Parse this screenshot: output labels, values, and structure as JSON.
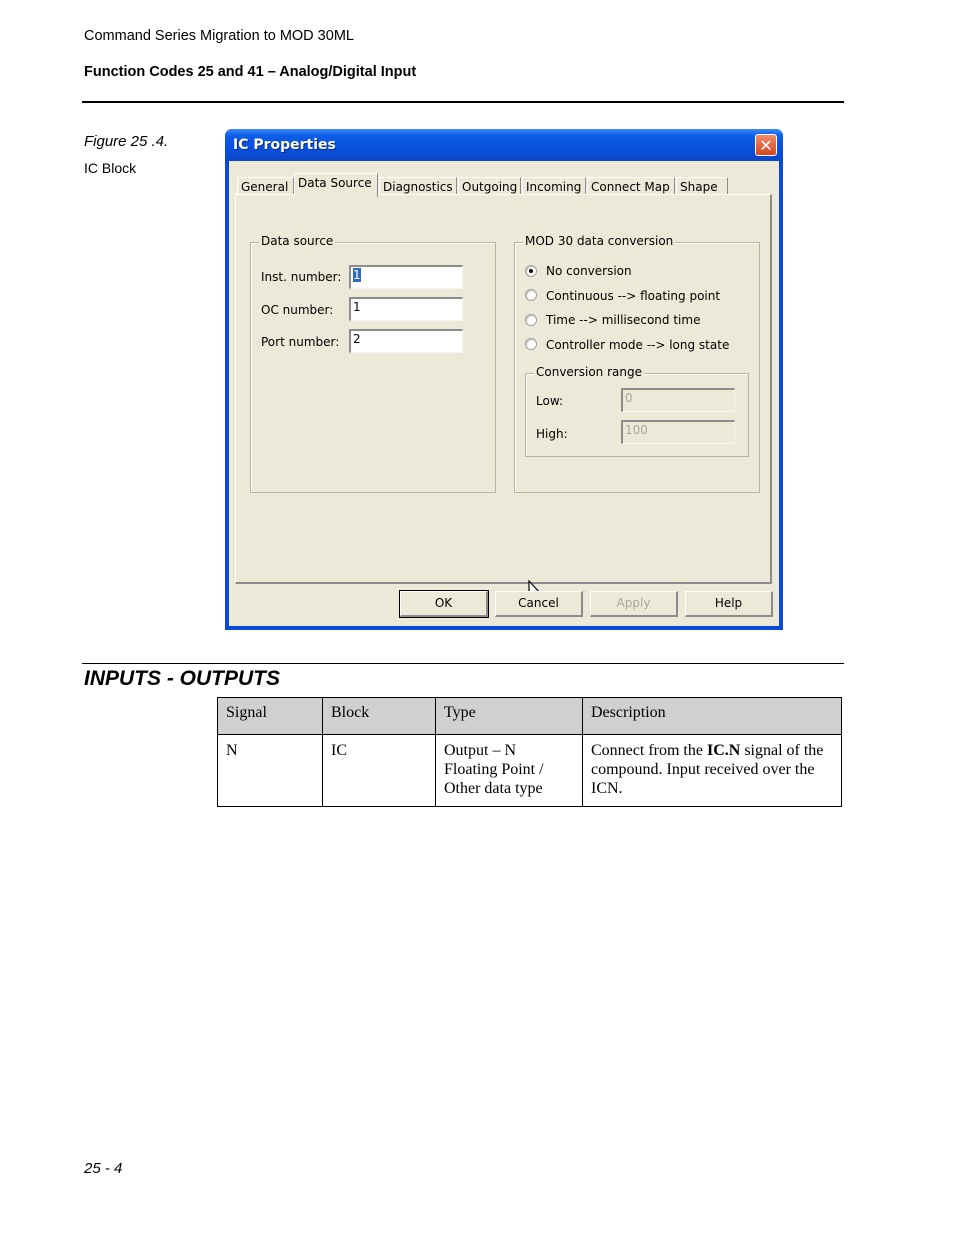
{
  "header": {
    "doc_title": "Command Series Migration to MOD 30ML",
    "section_title": "Function Codes 25 and 41 – Analog/Digital Input"
  },
  "figure": {
    "label": "Figure 25 .4.",
    "caption": "IC Block"
  },
  "dialog": {
    "title": "IC Properties",
    "close_icon": "close-icon",
    "tabs": [
      {
        "label": "General",
        "active": false
      },
      {
        "label": "Data Source",
        "active": true
      },
      {
        "label": "Diagnostics",
        "active": false
      },
      {
        "label": "Outgoing",
        "active": false
      },
      {
        "label": "Incoming",
        "active": false
      },
      {
        "label": "Connect Map",
        "active": false
      },
      {
        "label": "Shape",
        "active": false
      }
    ],
    "data_source": {
      "title": "Data source",
      "inst_label": "Inst. number:",
      "inst_value": "1",
      "oc_label": "OC number:",
      "oc_value": "1",
      "port_label": "Port number:",
      "port_value": "2"
    },
    "conversion": {
      "title": "MOD 30 data conversion",
      "options": [
        {
          "label": "No conversion",
          "selected": true
        },
        {
          "label": "Continuous --> floating point",
          "selected": false
        },
        {
          "label": "Time --> millisecond time",
          "selected": false
        },
        {
          "label": "Controller mode --> long state",
          "selected": false
        }
      ],
      "range": {
        "title": "Conversion range",
        "low_label": "Low:",
        "low_value": "0",
        "high_label": "High:",
        "high_value": "100"
      }
    },
    "buttons": {
      "ok": "OK",
      "cancel": "Cancel",
      "apply": "Apply",
      "help": "Help"
    }
  },
  "io_section": {
    "title": "INPUTS - OUTPUTS",
    "columns": [
      "Signal",
      "Block",
      "Type",
      "Description"
    ],
    "rows": [
      {
        "signal": "N",
        "block": "IC",
        "type_lines": [
          "Output – N",
          "Floating Point /",
          "Other data type"
        ],
        "desc_pre": "Connect from the ",
        "desc_bold": "IC.N",
        "desc_post": " signal of the compound. Input received over the ICN."
      }
    ]
  },
  "footer": {
    "page_number": "25 - 4"
  }
}
